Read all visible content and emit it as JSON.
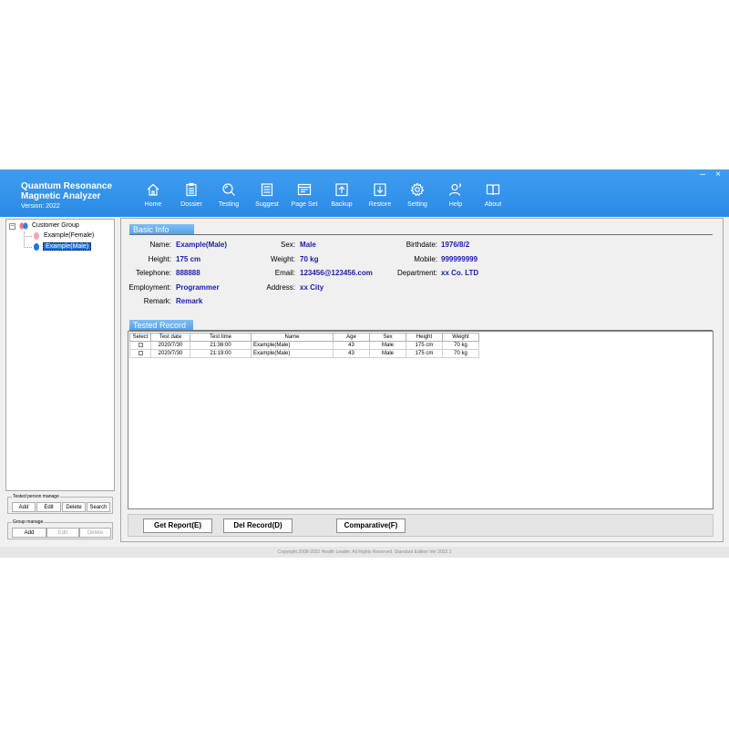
{
  "header": {
    "title_line1": "Quantum Resonance",
    "title_line2": "Magnetic Analyzer",
    "version": "Version: 2022",
    "minimize": "–",
    "close": "×",
    "toolbar": [
      {
        "label": "Home",
        "icon": "home-icon"
      },
      {
        "label": "Dossier",
        "icon": "clipboard-icon"
      },
      {
        "label": "Testing",
        "icon": "magnifier-icon"
      },
      {
        "label": "Suggest",
        "icon": "list-icon"
      },
      {
        "label": "Page Set",
        "icon": "window-icon"
      },
      {
        "label": "Backup",
        "icon": "upload-icon"
      },
      {
        "label": "Restore",
        "icon": "download-icon"
      },
      {
        "label": "Setting",
        "icon": "gear-icon"
      },
      {
        "label": "Help",
        "icon": "person-help-icon"
      },
      {
        "label": "About",
        "icon": "book-icon"
      }
    ]
  },
  "tree": {
    "root": "Customer Group",
    "toggle": "−",
    "children": [
      "Example(Female)",
      "Example(Male)"
    ],
    "selected_index": 1
  },
  "person_manage": {
    "title": "Tested person manage",
    "buttons": [
      "Add",
      "Edit",
      "Delete",
      "Search"
    ]
  },
  "group_manage": {
    "title": "Group manage",
    "buttons": [
      "Add",
      "Edit",
      "Delete"
    ]
  },
  "basic_info": {
    "title": "Basic Info",
    "name_label": "Name:",
    "name": "Example(Male)",
    "sex_label": "Sex:",
    "sex": "Male",
    "birthdate_label": "Birthdate:",
    "birthdate": "1976/8/2",
    "height_label": "Height:",
    "height": "175 cm",
    "weight_label": "Weight:",
    "weight": "70 kg",
    "mobile_label": "Mobile:",
    "mobile": "999999999",
    "telephone_label": "Telephone:",
    "telephone": "888888",
    "email_label": "Email:",
    "email": "123456@123456.com",
    "department_label": "Department:",
    "department": "xx  Co. LTD",
    "employment_label": "Employment:",
    "employment": "Programmer",
    "address_label": "Address:",
    "address": "xx City",
    "remark_label": "Remark:",
    "remark": "Remark"
  },
  "tested_record": {
    "title": "Tested Record",
    "columns": [
      "Select",
      "Test date",
      "Test time",
      "Name",
      "Age",
      "Sex",
      "Height",
      "Weight"
    ],
    "rows": [
      [
        "",
        "2020/7/30",
        "21:36:00",
        "Example(Male)",
        "43",
        "Male",
        "175 cm",
        "70 kg"
      ],
      [
        "",
        "2020/7/30",
        "21:19:00",
        "Example(Male)",
        "43",
        "Male",
        "175 cm",
        "70 kg"
      ]
    ]
  },
  "actions": {
    "get_report": "Get Report(E)",
    "del_record": "Del Record(D)",
    "comparative": "Comparative(F)"
  },
  "status": "Copyright 2008-2022 Health Leader. All Rights Reserved.  Standard Edition Ver 2022.1"
}
